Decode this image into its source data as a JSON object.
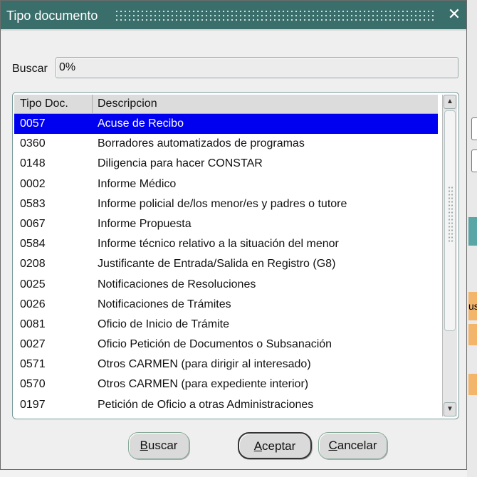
{
  "dialog": {
    "title": "Tipo documento",
    "close_glyph": "✕"
  },
  "search": {
    "label": "Buscar",
    "value": "0%"
  },
  "list": {
    "columns": [
      "Tipo Doc.",
      "Descripcion"
    ],
    "selected_index": 0,
    "rows": [
      {
        "code": "0057",
        "desc": "Acuse de Recibo"
      },
      {
        "code": "0360",
        "desc": "Borradores automatizados de programas"
      },
      {
        "code": "0148",
        "desc": "Diligencia para hacer CONSTAR"
      },
      {
        "code": "0002",
        "desc": "Informe Médico"
      },
      {
        "code": "0583",
        "desc": "Informe policial de/los menor/es y padres o tutore"
      },
      {
        "code": "0067",
        "desc": "Informe Propuesta"
      },
      {
        "code": "0584",
        "desc": "Informe técnico relativo a la situación del menor"
      },
      {
        "code": "0208",
        "desc": "Justificante de Entrada/Salida en Registro (G8)"
      },
      {
        "code": "0025",
        "desc": "Notificaciones de Resoluciones"
      },
      {
        "code": "0026",
        "desc": "Notificaciones de Trámites"
      },
      {
        "code": "0081",
        "desc": "Oficio de Inicio de Trámite"
      },
      {
        "code": "0027",
        "desc": "Oficio Petición de Documentos o Subsanación"
      },
      {
        "code": "0571",
        "desc": "Otros CARMEN (para dirigir al interesado)"
      },
      {
        "code": "0570",
        "desc": "Otros CARMEN (para expediente interior)"
      },
      {
        "code": "0197",
        "desc": "Petición de Oficio a otras Administraciones"
      }
    ]
  },
  "buttons": {
    "search_first": "B",
    "search_rest": "uscar",
    "accept_first": "A",
    "accept_rest": "ceptar",
    "cancel_first": "C",
    "cancel_rest": "ancelar"
  },
  "background": {
    "fragment_text": "us"
  },
  "colors": {
    "titlebar": "#3a6e6b",
    "selection": "#0000f0"
  }
}
